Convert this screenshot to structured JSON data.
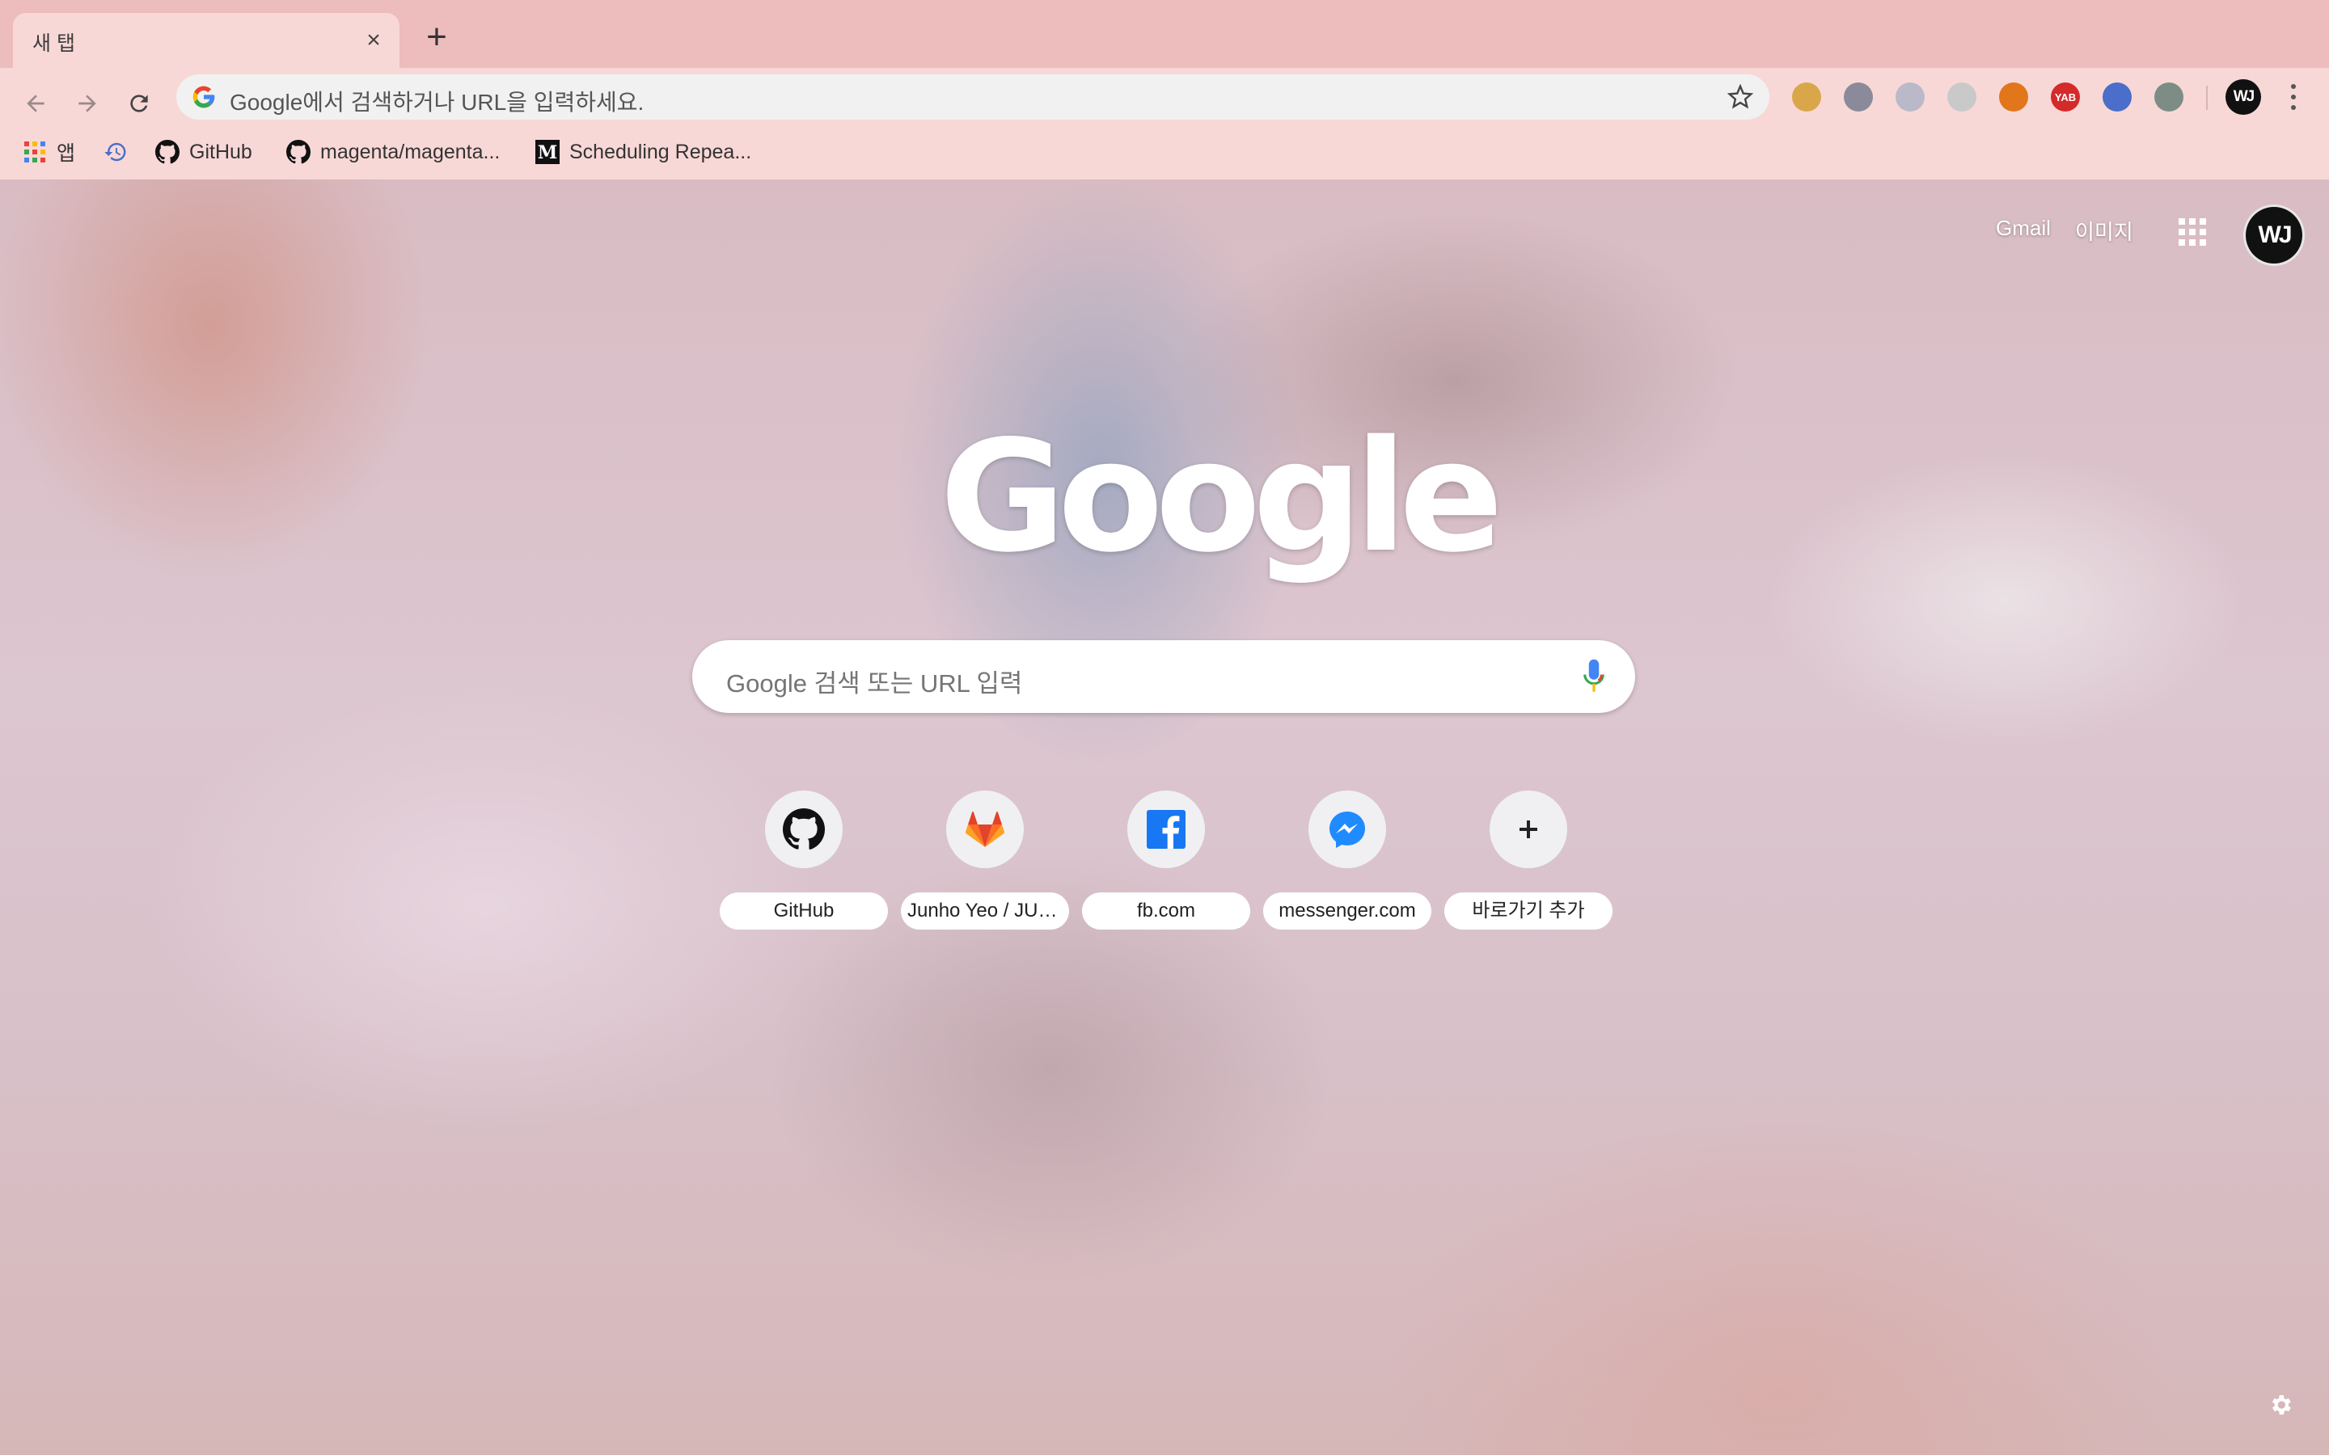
{
  "tab": {
    "title": "새 탭"
  },
  "omnibox": {
    "placeholder": "Google에서 검색하거나 URL을 입력하세요."
  },
  "extensions": [
    {
      "name": "cookie-extension-icon",
      "color": "#d9a74a",
      "label": ""
    },
    {
      "name": "mascot-extension-icon",
      "color": "#8a8a9a",
      "label": ""
    },
    {
      "name": "discord-extension-icon",
      "color": "#b9b9c9",
      "label": ""
    },
    {
      "name": "camera-extension-icon",
      "color": "#c9c9c9",
      "label": ""
    },
    {
      "name": "metamask-extension-icon",
      "color": "#e2761b",
      "label": ""
    },
    {
      "name": "yab-extension-icon",
      "color": "#d42a2a",
      "label": "YAB"
    },
    {
      "name": "glasses-extension-icon",
      "color": "#4a6ec9",
      "label": ""
    },
    {
      "name": "vue-devtools-extension-icon",
      "color": "#7d8d86",
      "label": ""
    }
  ],
  "bookmarks": [
    {
      "label": "앱"
    },
    {
      "label": ""
    },
    {
      "label": "GitHub"
    },
    {
      "label": "magenta/magenta..."
    },
    {
      "label": "Scheduling Repea..."
    }
  ],
  "ntp": {
    "gmail": "Gmail",
    "images": "이미지",
    "avatar_text": "WJ",
    "logo": "Google",
    "search_placeholder": "Google 검색 또는 URL 입력",
    "shortcuts": [
      {
        "label": "GitHub"
      },
      {
        "label": "Junho Yeo / JUNHO.IO"
      },
      {
        "label": "fb.com"
      },
      {
        "label": "messenger.com"
      },
      {
        "label": "바로가기 추가"
      }
    ]
  },
  "colors": {
    "tabstrip": "#edbcbc",
    "toolbar": "#f8d8d6",
    "logo_blue": "#4285f4",
    "logo_red": "#ea4335",
    "logo_yellow": "#fbbc05",
    "logo_green": "#34a853",
    "facebook": "#1877f2",
    "messenger": "#1f8bff",
    "gitlab": "#e24329"
  }
}
